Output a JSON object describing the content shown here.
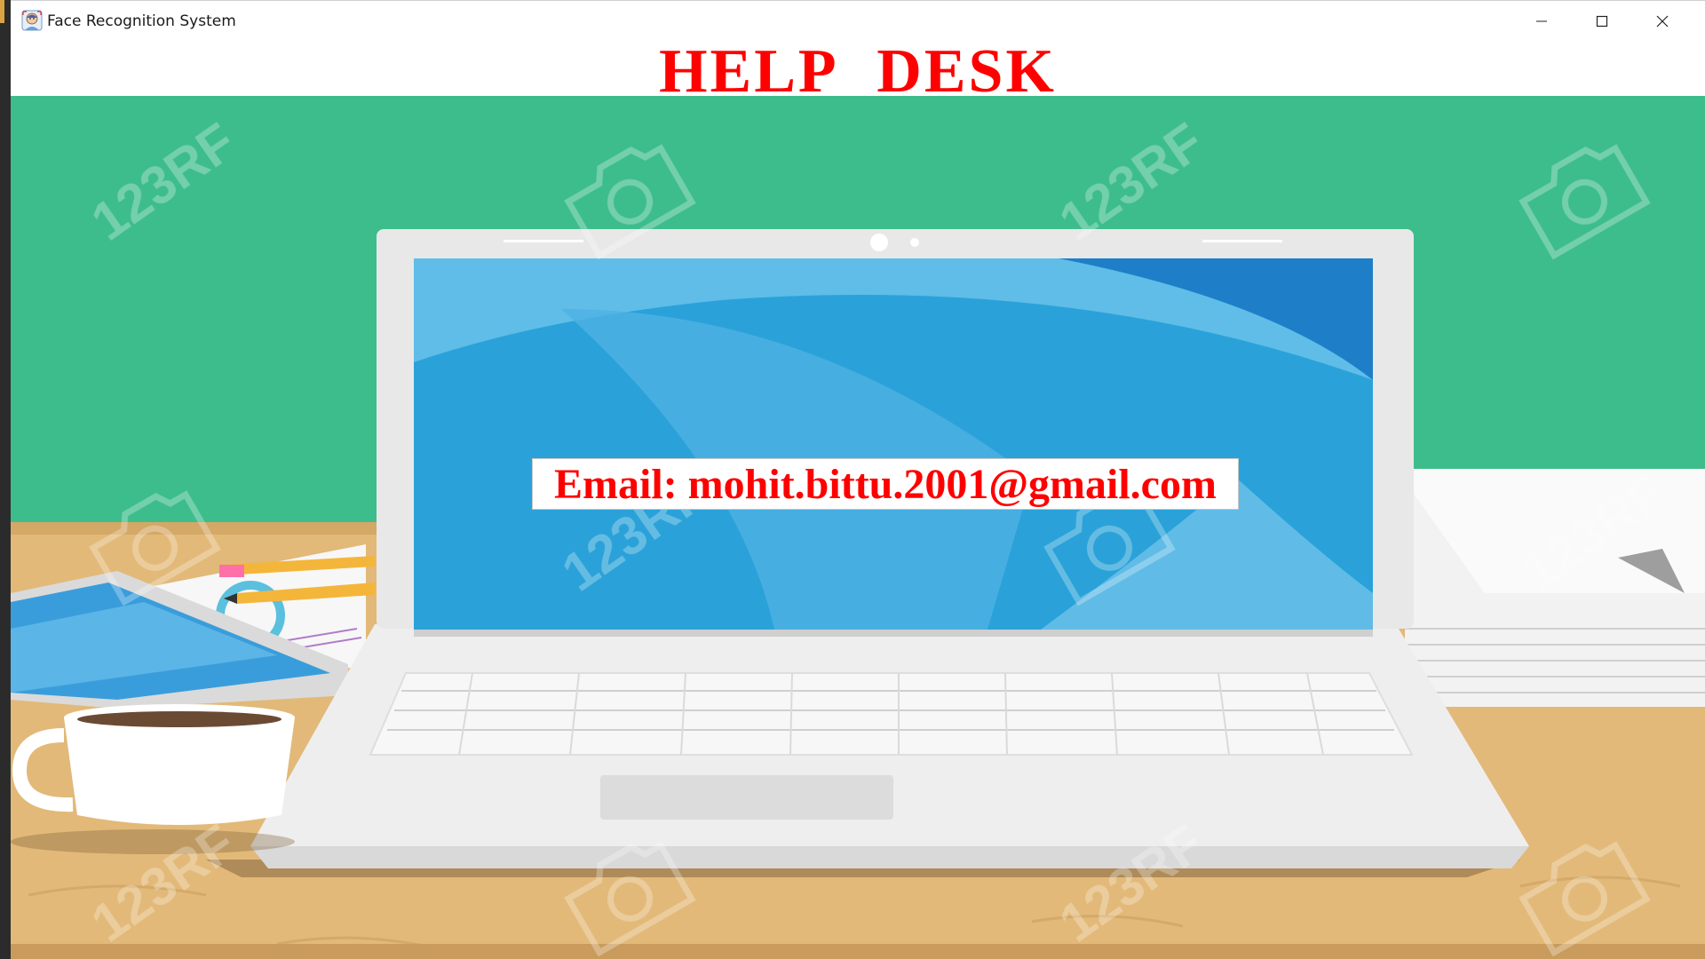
{
  "window": {
    "title": "Face Recognition System",
    "controls": [
      "minimize",
      "maximize",
      "close"
    ]
  },
  "page": {
    "heading": "HELP  DESK",
    "email_text": "Email: mohit.bittu.2001@gmail.com"
  },
  "background": {
    "description_icons": [
      "camera-watermark-icon"
    ],
    "watermark_text": "123RF"
  },
  "colors": {
    "heading": "#ff0000",
    "wall": "#3dbd8c",
    "desk": "#e0b674",
    "screen": "#2aa2d9"
  }
}
